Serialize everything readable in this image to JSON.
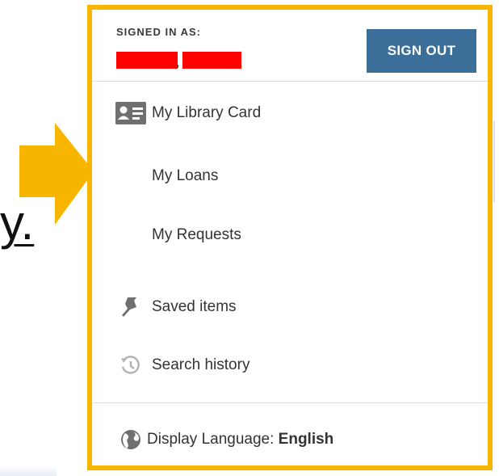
{
  "background": {
    "fragment_text": "y.",
    "arrow_color": "#f7b500"
  },
  "panel": {
    "border_color": "#f7b500",
    "signed_in_label": "SIGNED IN AS:",
    "name_separator": ",",
    "redaction_color": "#ff0000",
    "sign_out_label": "SIGN OUT",
    "sign_out_color": "#3b6e98"
  },
  "menu": {
    "items": [
      {
        "label": "My Library Card",
        "icon": "library-card-icon"
      },
      {
        "label": "My Loans",
        "icon": ""
      },
      {
        "label": "My Requests",
        "icon": ""
      },
      {
        "label": "Saved items",
        "icon": "pin-icon"
      },
      {
        "label": "Search history",
        "icon": "history-icon"
      }
    ],
    "language": {
      "label": "Display Language: ",
      "value": "English",
      "icon": "globe-icon"
    }
  }
}
